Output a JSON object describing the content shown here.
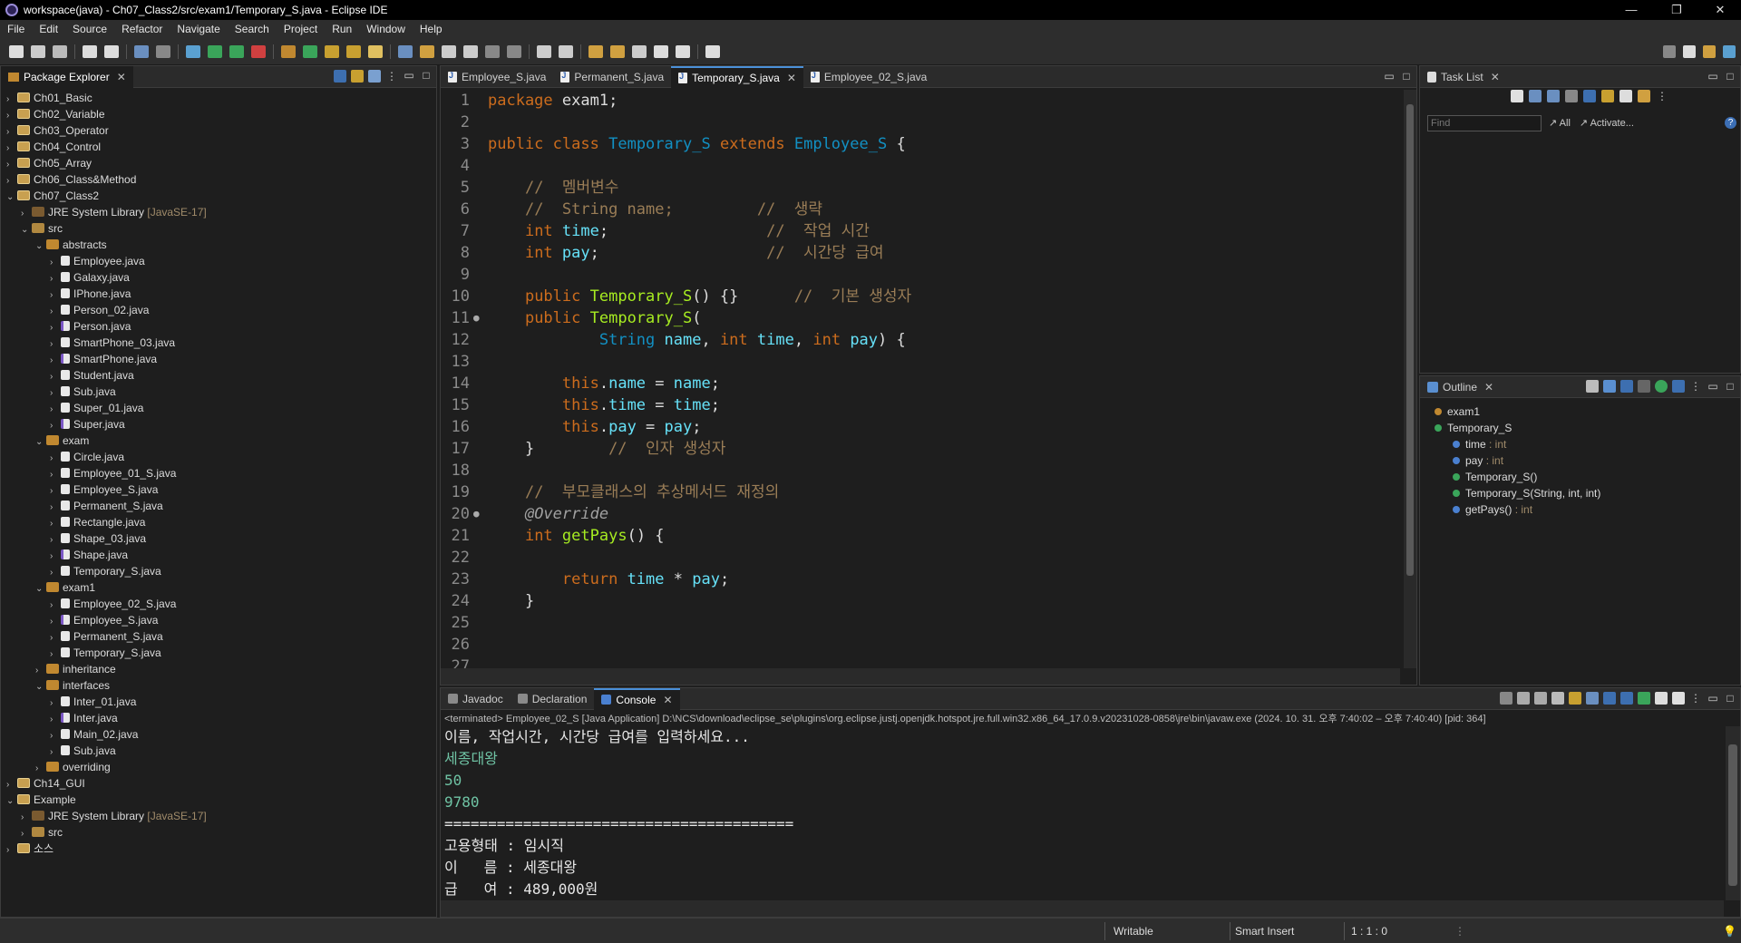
{
  "window": {
    "title": "workspace(java) - Ch07_Class2/src/exam1/Temporary_S.java - Eclipse IDE",
    "min": "—",
    "max": "❐",
    "close": "✕"
  },
  "menu": [
    "File",
    "Edit",
    "Source",
    "Refactor",
    "Navigate",
    "Search",
    "Project",
    "Run",
    "Window",
    "Help"
  ],
  "package_explorer": {
    "title": "Package Explorer",
    "items": [
      {
        "indent": 0,
        "arrow": "›",
        "icon": "proj",
        "label": "Ch01_Basic"
      },
      {
        "indent": 0,
        "arrow": "›",
        "icon": "proj",
        "label": "Ch02_Variable"
      },
      {
        "indent": 0,
        "arrow": "›",
        "icon": "proj",
        "label": "Ch03_Operator"
      },
      {
        "indent": 0,
        "arrow": "›",
        "icon": "proj",
        "label": "Ch04_Control"
      },
      {
        "indent": 0,
        "arrow": "›",
        "icon": "proj",
        "label": "Ch05_Array"
      },
      {
        "indent": 0,
        "arrow": "›",
        "icon": "proj",
        "label": "Ch06_Class&Method"
      },
      {
        "indent": 0,
        "arrow": "⌄",
        "icon": "proj",
        "label": "Ch07_Class2"
      },
      {
        "indent": 1,
        "arrow": "›",
        "icon": "lib",
        "label": "JRE System Library",
        "suffix": "[JavaSE-17]"
      },
      {
        "indent": 1,
        "arrow": "⌄",
        "icon": "src",
        "label": "src"
      },
      {
        "indent": 2,
        "arrow": "⌄",
        "icon": "pkg",
        "label": "abstracts"
      },
      {
        "indent": 3,
        "arrow": "›",
        "icon": "java",
        "label": "Employee.java"
      },
      {
        "indent": 3,
        "arrow": "›",
        "icon": "java",
        "label": "Galaxy.java"
      },
      {
        "indent": 3,
        "arrow": "›",
        "icon": "java",
        "label": "IPhone.java"
      },
      {
        "indent": 3,
        "arrow": "›",
        "icon": "java",
        "label": "Person_02.java"
      },
      {
        "indent": 3,
        "arrow": "›",
        "icon": "javai",
        "label": "Person.java"
      },
      {
        "indent": 3,
        "arrow": "›",
        "icon": "java",
        "label": "SmartPhone_03.java"
      },
      {
        "indent": 3,
        "arrow": "›",
        "icon": "javai",
        "label": "SmartPhone.java"
      },
      {
        "indent": 3,
        "arrow": "›",
        "icon": "java",
        "label": "Student.java"
      },
      {
        "indent": 3,
        "arrow": "›",
        "icon": "java",
        "label": "Sub.java"
      },
      {
        "indent": 3,
        "arrow": "›",
        "icon": "java",
        "label": "Super_01.java"
      },
      {
        "indent": 3,
        "arrow": "›",
        "icon": "javai",
        "label": "Super.java"
      },
      {
        "indent": 2,
        "arrow": "⌄",
        "icon": "pkg",
        "label": "exam"
      },
      {
        "indent": 3,
        "arrow": "›",
        "icon": "java",
        "label": "Circle.java"
      },
      {
        "indent": 3,
        "arrow": "›",
        "icon": "java",
        "label": "Employee_01_S.java"
      },
      {
        "indent": 3,
        "arrow": "›",
        "icon": "java",
        "label": "Employee_S.java"
      },
      {
        "indent": 3,
        "arrow": "›",
        "icon": "java",
        "label": "Permanent_S.java"
      },
      {
        "indent": 3,
        "arrow": "›",
        "icon": "java",
        "label": "Rectangle.java"
      },
      {
        "indent": 3,
        "arrow": "›",
        "icon": "java",
        "label": "Shape_03.java"
      },
      {
        "indent": 3,
        "arrow": "›",
        "icon": "javai",
        "label": "Shape.java"
      },
      {
        "indent": 3,
        "arrow": "›",
        "icon": "java",
        "label": "Temporary_S.java"
      },
      {
        "indent": 2,
        "arrow": "⌄",
        "icon": "pkg",
        "label": "exam1"
      },
      {
        "indent": 3,
        "arrow": "›",
        "icon": "java",
        "label": "Employee_02_S.java"
      },
      {
        "indent": 3,
        "arrow": "›",
        "icon": "javai",
        "label": "Employee_S.java"
      },
      {
        "indent": 3,
        "arrow": "›",
        "icon": "java",
        "label": "Permanent_S.java"
      },
      {
        "indent": 3,
        "arrow": "›",
        "icon": "java",
        "label": "Temporary_S.java"
      },
      {
        "indent": 2,
        "arrow": "›",
        "icon": "pkg",
        "label": "inheritance"
      },
      {
        "indent": 2,
        "arrow": "⌄",
        "icon": "pkg",
        "label": "interfaces"
      },
      {
        "indent": 3,
        "arrow": "›",
        "icon": "java",
        "label": "Inter_01.java"
      },
      {
        "indent": 3,
        "arrow": "›",
        "icon": "javai",
        "label": "Inter.java"
      },
      {
        "indent": 3,
        "arrow": "›",
        "icon": "java",
        "label": "Main_02.java"
      },
      {
        "indent": 3,
        "arrow": "›",
        "icon": "java",
        "label": "Sub.java"
      },
      {
        "indent": 2,
        "arrow": "›",
        "icon": "pkg",
        "label": "overriding"
      },
      {
        "indent": 0,
        "arrow": "›",
        "icon": "proj",
        "label": "Ch14_GUI"
      },
      {
        "indent": 0,
        "arrow": "⌄",
        "icon": "proj",
        "label": "Example"
      },
      {
        "indent": 1,
        "arrow": "›",
        "icon": "lib",
        "label": "JRE System Library",
        "suffix": "[JavaSE-17]"
      },
      {
        "indent": 1,
        "arrow": "›",
        "icon": "src",
        "label": "src"
      },
      {
        "indent": 0,
        "arrow": "›",
        "icon": "proj",
        "label": "소스"
      }
    ]
  },
  "editor": {
    "tabs": [
      {
        "label": "Employee_S.java",
        "active": false
      },
      {
        "label": "Permanent_S.java",
        "active": false
      },
      {
        "label": "Temporary_S.java",
        "active": true
      },
      {
        "label": "Employee_02_S.java",
        "active": false
      }
    ],
    "lines": [
      {
        "n": "1",
        "m": "",
        "t": [
          [
            "kw",
            "package"
          ],
          [
            "ct",
            " exam1;"
          ]
        ]
      },
      {
        "n": "2",
        "m": "",
        "t": []
      },
      {
        "n": "3",
        "m": "",
        "t": [
          [
            "kw",
            "public"
          ],
          [
            "ct",
            " "
          ],
          [
            "kw",
            "class"
          ],
          [
            "ct",
            " "
          ],
          [
            "ty",
            "Temporary_S"
          ],
          [
            "ct",
            " "
          ],
          [
            "kw",
            "extends"
          ],
          [
            "ct",
            " "
          ],
          [
            "ty",
            "Employee_S"
          ],
          [
            "ct",
            " {"
          ]
        ]
      },
      {
        "n": "4",
        "m": "",
        "t": []
      },
      {
        "n": "5",
        "m": "",
        "t": [
          [
            "ct",
            "    "
          ],
          [
            "cmt",
            "//  멤버변수"
          ]
        ]
      },
      {
        "n": "6",
        "m": "",
        "t": [
          [
            "ct",
            "    "
          ],
          [
            "cmt",
            "//  String name;         //  생략"
          ]
        ]
      },
      {
        "n": "7",
        "m": "",
        "t": [
          [
            "ct",
            "    "
          ],
          [
            "kw",
            "int"
          ],
          [
            "ct",
            " "
          ],
          [
            "fd",
            "time"
          ],
          [
            "ct",
            ";                 "
          ],
          [
            "cmt",
            "//  작업 시간"
          ]
        ]
      },
      {
        "n": "8",
        "m": "",
        "t": [
          [
            "ct",
            "    "
          ],
          [
            "kw",
            "int"
          ],
          [
            "ct",
            " "
          ],
          [
            "fd",
            "pay"
          ],
          [
            "ct",
            ";                  "
          ],
          [
            "cmt",
            "//  시간당 급여"
          ]
        ]
      },
      {
        "n": "9",
        "m": "",
        "t": []
      },
      {
        "n": "10",
        "m": "",
        "t": [
          [
            "ct",
            "    "
          ],
          [
            "kw",
            "public"
          ],
          [
            "ct",
            " "
          ],
          [
            "nm",
            "Temporary_S"
          ],
          [
            "ct",
            "() {}      "
          ],
          [
            "cmt",
            "//  기본 생성자"
          ]
        ]
      },
      {
        "n": "11",
        "m": "●",
        "t": [
          [
            "ct",
            "    "
          ],
          [
            "kw",
            "public"
          ],
          [
            "ct",
            " "
          ],
          [
            "nm",
            "Temporary_S"
          ],
          [
            "ct",
            "("
          ]
        ]
      },
      {
        "n": "12",
        "m": "",
        "t": [
          [
            "ct",
            "            "
          ],
          [
            "ty",
            "String"
          ],
          [
            "ct",
            " "
          ],
          [
            "fd",
            "name"
          ],
          [
            "ct",
            ", "
          ],
          [
            "kw",
            "int"
          ],
          [
            "ct",
            " "
          ],
          [
            "fd",
            "time"
          ],
          [
            "ct",
            ", "
          ],
          [
            "kw",
            "int"
          ],
          [
            "ct",
            " "
          ],
          [
            "fd",
            "pay"
          ],
          [
            "ct",
            ") {"
          ]
        ]
      },
      {
        "n": "13",
        "m": "",
        "t": []
      },
      {
        "n": "14",
        "m": "",
        "t": [
          [
            "ct",
            "        "
          ],
          [
            "kw",
            "this"
          ],
          [
            "ct",
            "."
          ],
          [
            "fd",
            "name"
          ],
          [
            "ct",
            " = "
          ],
          [
            "fd",
            "name"
          ],
          [
            "ct",
            ";"
          ]
        ]
      },
      {
        "n": "15",
        "m": "",
        "t": [
          [
            "ct",
            "        "
          ],
          [
            "kw",
            "this"
          ],
          [
            "ct",
            "."
          ],
          [
            "fd",
            "time"
          ],
          [
            "ct",
            " = "
          ],
          [
            "fd",
            "time"
          ],
          [
            "ct",
            ";"
          ]
        ]
      },
      {
        "n": "16",
        "m": "",
        "t": [
          [
            "ct",
            "        "
          ],
          [
            "kw",
            "this"
          ],
          [
            "ct",
            "."
          ],
          [
            "fd",
            "pay"
          ],
          [
            "ct",
            " = "
          ],
          [
            "fd",
            "pay"
          ],
          [
            "ct",
            ";"
          ]
        ]
      },
      {
        "n": "17",
        "m": "",
        "t": [
          [
            "ct",
            "    }        "
          ],
          [
            "cmt",
            "//  인자 생성자"
          ]
        ]
      },
      {
        "n": "18",
        "m": "",
        "t": []
      },
      {
        "n": "19",
        "m": "",
        "t": [
          [
            "ct",
            "    "
          ],
          [
            "cmt",
            "//  부모클래스의 추상메서드 재정의"
          ]
        ]
      },
      {
        "n": "20",
        "m": "●",
        "t": [
          [
            "ct",
            "    "
          ],
          [
            "an",
            "@Override"
          ]
        ]
      },
      {
        "n": "21",
        "m": "",
        "t": [
          [
            "ct",
            "    "
          ],
          [
            "kw",
            "int"
          ],
          [
            "ct",
            " "
          ],
          [
            "nm",
            "getPays"
          ],
          [
            "ct",
            "() {"
          ]
        ]
      },
      {
        "n": "22",
        "m": "",
        "t": []
      },
      {
        "n": "23",
        "m": "",
        "t": [
          [
            "ct",
            "        "
          ],
          [
            "kw",
            "return"
          ],
          [
            "ct",
            " "
          ],
          [
            "fd",
            "time"
          ],
          [
            "ct",
            " * "
          ],
          [
            "fd",
            "pay"
          ],
          [
            "ct",
            ";"
          ]
        ]
      },
      {
        "n": "24",
        "m": "",
        "t": [
          [
            "ct",
            "    }"
          ]
        ]
      },
      {
        "n": "25",
        "m": "",
        "t": []
      },
      {
        "n": "26",
        "m": "",
        "t": []
      },
      {
        "n": "27",
        "m": "",
        "t": []
      }
    ]
  },
  "task_list": {
    "title": "Task List",
    "find_placeholder": "Find",
    "all": "All",
    "activate": "Activate..."
  },
  "outline": {
    "title": "Outline",
    "items": [
      {
        "indent": 0,
        "dot": "#c08830",
        "label": "exam1",
        "type": ""
      },
      {
        "indent": 0,
        "dot": "#3aa55a",
        "label": "Temporary_S",
        "type": ""
      },
      {
        "indent": 1,
        "dot": "#4a80d0",
        "label": "time",
        "type": " : int"
      },
      {
        "indent": 1,
        "dot": "#4a80d0",
        "label": "pay",
        "type": " : int"
      },
      {
        "indent": 1,
        "dot": "#3aa55a",
        "label": "Temporary_S()",
        "type": ""
      },
      {
        "indent": 1,
        "dot": "#3aa55a",
        "label": "Temporary_S(String, int, int)",
        "type": ""
      },
      {
        "indent": 1,
        "dot": "#4a80d0",
        "label": "getPays()",
        "type": " : int"
      }
    ]
  },
  "bottom": {
    "tabs": [
      {
        "label": "Javadoc",
        "active": false
      },
      {
        "label": "Declaration",
        "active": false
      },
      {
        "label": "Console",
        "active": true
      }
    ],
    "console_header": "<terminated> Employee_02_S [Java Application] D:\\NCS\\download\\eclipse_se\\plugins\\org.eclipse.justj.openjdk.hotspot.jre.full.win32.x86_64_17.0.9.v20231028-0858\\jre\\bin\\javaw.exe  (2024. 10. 31. 오후 7:40:02 – 오후 7:40:40) [pid: 364]",
    "console_lines": [
      {
        "kind": "out",
        "text": "이름, 작업시간, 시간당 급여를 입력하세요..."
      },
      {
        "kind": "inp",
        "text": "세종대왕"
      },
      {
        "kind": "inp",
        "text": "50"
      },
      {
        "kind": "inp",
        "text": "9780"
      },
      {
        "kind": "out",
        "text": "========================================"
      },
      {
        "kind": "out",
        "text": "고용형태 : 임시직"
      },
      {
        "kind": "out",
        "text": "이   름 : 세종대왕"
      },
      {
        "kind": "out",
        "text": "급   여 : 489,000원"
      }
    ]
  },
  "status": {
    "writable": "Writable",
    "insert": "Smart Insert",
    "position": "1 : 1 : 0"
  }
}
